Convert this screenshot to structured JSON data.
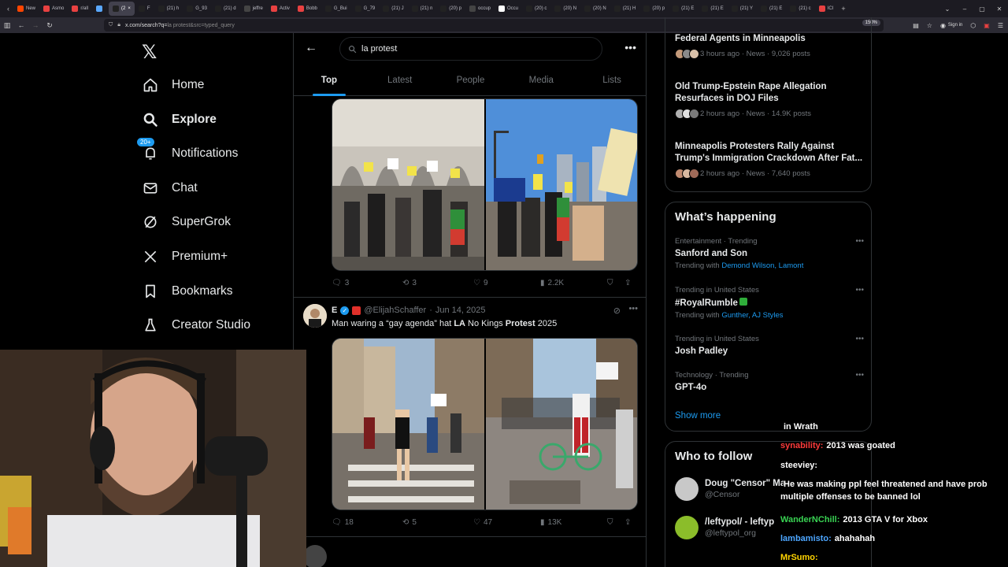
{
  "browser": {
    "tabs": [
      {
        "label": "New",
        "color": "#ff4500"
      },
      {
        "label": "Asmo",
        "color": "#e84141"
      },
      {
        "label": "r/all",
        "color": "#e84141"
      },
      {
        "label": "",
        "color": "#5aa8ff"
      },
      {
        "label": "(2",
        "color": "#222222",
        "active": true
      },
      {
        "label": "F",
        "color": "#222222"
      },
      {
        "label": "(21) h",
        "color": "#222222"
      },
      {
        "label": "G_93",
        "color": "#222222"
      },
      {
        "label": "(21) d",
        "color": "#222222"
      },
      {
        "label": "jeffre",
        "color": "#444444"
      },
      {
        "label": "Activ",
        "color": "#e84141"
      },
      {
        "label": "Bobb",
        "color": "#e84141"
      },
      {
        "label": "G_Bui",
        "color": "#222222"
      },
      {
        "label": "G_79",
        "color": "#222222"
      },
      {
        "label": "(21) J",
        "color": "#222222"
      },
      {
        "label": "(21) n",
        "color": "#222222"
      },
      {
        "label": "(20) p",
        "color": "#222222"
      },
      {
        "label": "occup",
        "color": "#444444"
      },
      {
        "label": "Occu",
        "color": "#ffffff"
      },
      {
        "label": "(20) c",
        "color": "#222222"
      },
      {
        "label": "(20) N",
        "color": "#222222"
      },
      {
        "label": "(20) N",
        "color": "#222222"
      },
      {
        "label": "(21) H",
        "color": "#222222"
      },
      {
        "label": "(20) p",
        "color": "#222222"
      },
      {
        "label": "(21) E",
        "color": "#222222"
      },
      {
        "label": "(21) E",
        "color": "#222222"
      },
      {
        "label": "(21) Y",
        "color": "#222222"
      },
      {
        "label": "(21) E",
        "color": "#222222"
      },
      {
        "label": "(21) c",
        "color": "#222222"
      },
      {
        "label": "ICI",
        "color": "#e84141"
      }
    ],
    "url_host": "x.com/search?q=",
    "url_path": "la protest&src=typed_query",
    "zoom": "150%",
    "sign_in": "Sign in"
  },
  "nav": {
    "items": [
      {
        "label": "Home",
        "icon": "home-icon"
      },
      {
        "label": "Explore",
        "icon": "search-icon",
        "bold": true
      },
      {
        "label": "Notifications",
        "icon": "bell-icon",
        "badge": "20+"
      },
      {
        "label": "Chat",
        "icon": "mail-icon"
      },
      {
        "label": "SuperGrok",
        "icon": "grok-icon"
      },
      {
        "label": "Premium+",
        "icon": "x-icon"
      },
      {
        "label": "Bookmarks",
        "icon": "bookmark-icon"
      },
      {
        "label": "Creator Studio",
        "icon": "flask-icon"
      }
    ]
  },
  "search": {
    "query": "la protest",
    "tabs": [
      "Top",
      "Latest",
      "People",
      "Media",
      "Lists"
    ],
    "active_tab": "Top"
  },
  "tweets": [
    {
      "replies": "3",
      "reposts": "3",
      "likes": "9",
      "views": "2.2K"
    },
    {
      "name": "E",
      "handle": "@ElijahSchaffer",
      "date": "Jun 14, 2025",
      "text_before": "Man waring a “gay agenda” hat ",
      "text_la": "LA",
      "text_mid": " No Kings ",
      "text_protest": "Protest",
      "text_after": " 2025",
      "replies": "18",
      "reposts": "5",
      "likes": "47",
      "views": "13K"
    }
  ],
  "news": [
    {
      "title": "Federal Agents in Minneapolis",
      "meta": "3 hours ago · News · 9,026 posts"
    },
    {
      "title": "Old Trump-Epstein Rape Allegation Resurfaces in DOJ Files",
      "meta": "2 hours ago · News · 14.9K posts"
    },
    {
      "title": "Minneapolis Protesters Rally Against Trump's Immigration Crackdown After Fat...",
      "meta": "2 hours ago · News · 7,640 posts"
    }
  ],
  "happening": {
    "title": "What’s happening",
    "trends": [
      {
        "category": "Entertainment · Trending",
        "name": "Sanford and Son",
        "with_label": "Trending with",
        "with": "Demond Wilson, Lamont"
      },
      {
        "category": "Trending in United States",
        "name": "#RoyalRumble",
        "with_label": "Trending with",
        "with": "Gunther, AJ Styles"
      },
      {
        "category": "Trending in United States",
        "name": "Josh Padley",
        "with_label": "",
        "with": ""
      },
      {
        "category": "Technology · Trending",
        "name": "GPT-4o",
        "with_label": "",
        "with": ""
      }
    ],
    "show_more": "Show more"
  },
  "who_to_follow": {
    "title": "Who to follow",
    "accounts": [
      {
        "name": "Doug \"Censor\" Ma",
        "handle": "@Censor"
      },
      {
        "name": "/leftypol/ - leftyp",
        "handle": "@leftypol_org"
      }
    ]
  },
  "chat": [
    {
      "user": "",
      "text": "in Wrath",
      "color": "#ffffff"
    },
    {
      "user": "synability:",
      "text": "2013 was goated",
      "color": "#ff3b3b"
    },
    {
      "user": "steeviey:",
      "text": "",
      "color": "#ffffff"
    },
    {
      "user": "",
      "text": "He was making ppl feel threatened and have prob multiple offenses to be banned lol",
      "color": "#ff3b3b"
    },
    {
      "user": "WanderNChill:",
      "text": "2013 GTA V for Xbox",
      "color": "#39d353"
    },
    {
      "user": "lambamisto:",
      "text": "ahahahah",
      "color": "#4da6ff"
    },
    {
      "user": "MrSumo:",
      "text": "",
      "color": "#ffd400"
    }
  ],
  "colors": {
    "accent": "#1d9bf0",
    "bg": "#000000",
    "border": "#2f3336",
    "muted": "#71767b"
  }
}
